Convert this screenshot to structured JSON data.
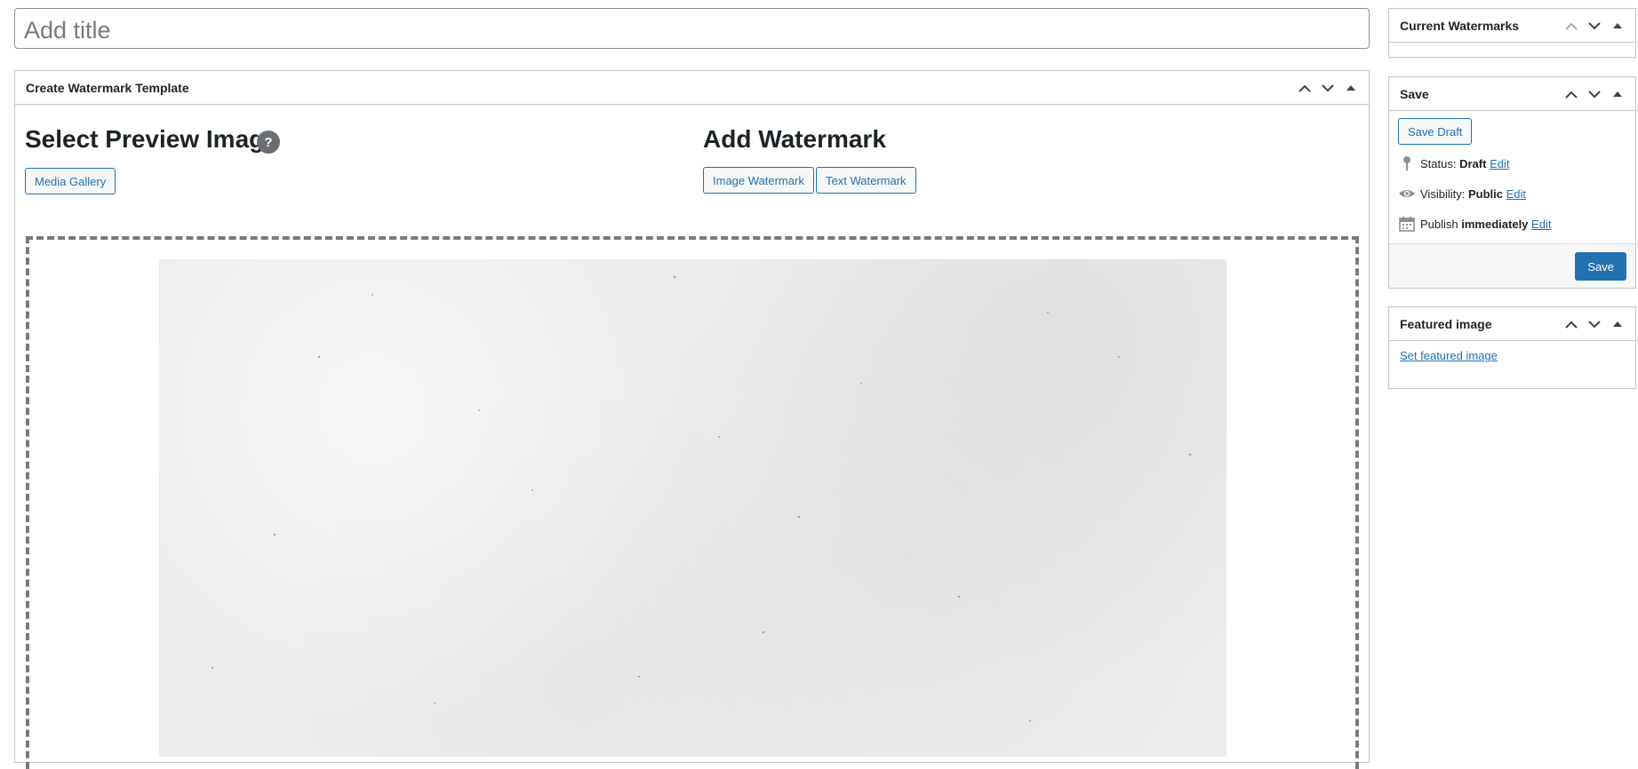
{
  "title_input": {
    "placeholder": "Add title",
    "value": ""
  },
  "main_box": {
    "title": "Create Watermark Template",
    "select_preview": {
      "heading": "Select Preview Image",
      "help": "?",
      "media_gallery": "Media Gallery"
    },
    "add_watermark": {
      "heading": "Add Watermark",
      "image_btn": "Image Watermark",
      "text_btn": "Text Watermark"
    }
  },
  "sidebar": {
    "current": {
      "title": "Current Watermarks"
    },
    "save": {
      "title": "Save",
      "save_draft": "Save Draft",
      "status_label": "Status:",
      "status_value": "Draft",
      "visibility_label": "Visibility:",
      "visibility_value": "Public",
      "publish_label": "Publish",
      "publish_value": "immediately",
      "edit": "Edit",
      "save_btn": "Save"
    },
    "featured": {
      "title": "Featured image",
      "link": "Set featured image"
    }
  },
  "icons": {
    "up": "chevron-up-icon",
    "down": "chevron-down-icon",
    "toggle": "caret-up-icon",
    "status": "pin-icon",
    "visibility": "eye-icon",
    "publish": "calendar-icon"
  },
  "colors": {
    "accent": "#2271b1",
    "border": "#c3c4c7",
    "text": "#1d2327"
  }
}
